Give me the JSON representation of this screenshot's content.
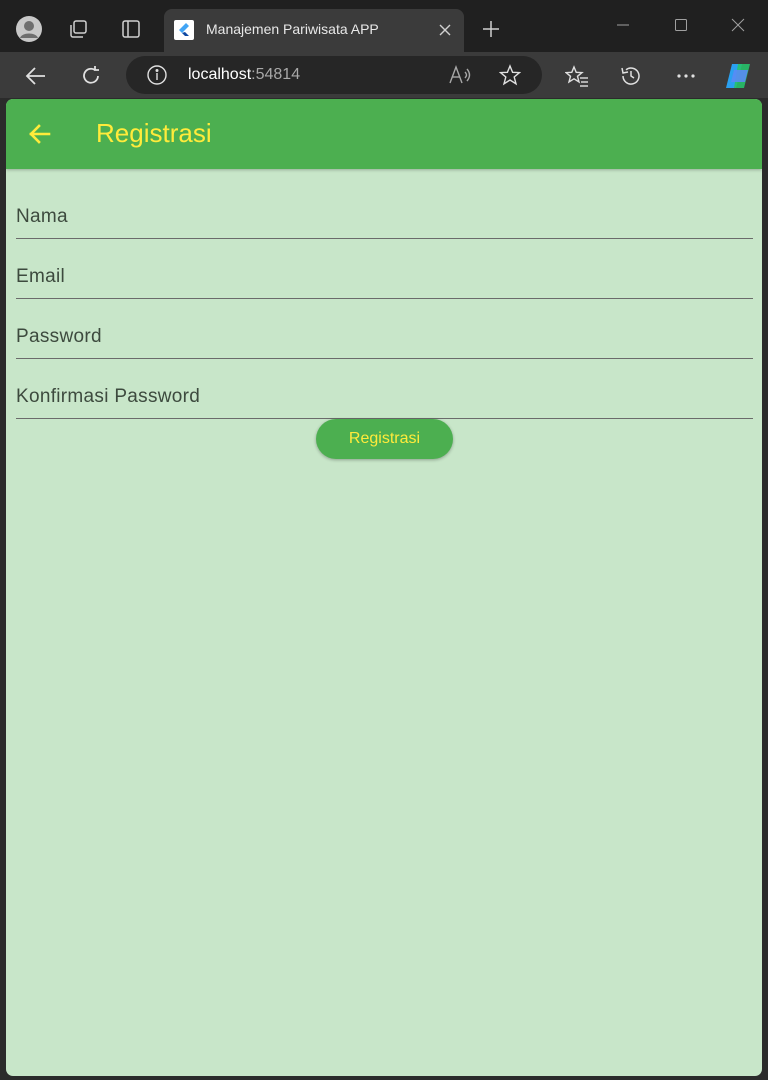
{
  "browser": {
    "tab_title": "Manajemen Pariwisata APP",
    "url_host": "localhost",
    "url_port": ":54814",
    "icons": [
      "profile-icon",
      "workspaces-icon",
      "tab-actions-icon",
      "favicon-icon",
      "tab-close-icon",
      "new-tab-icon",
      "minimize-icon",
      "maximize-icon",
      "close-icon",
      "back-icon",
      "refresh-icon",
      "site-info-icon",
      "read-aloud-icon",
      "favorite-star-icon",
      "favorites-icon",
      "history-icon",
      "more-icon",
      "copilot-icon"
    ]
  },
  "app": {
    "title": "Registrasi",
    "colors": {
      "appbar": "#4caf50",
      "title": "#ffeb3b",
      "background": "#c8e6c9"
    },
    "fields": [
      {
        "label": "Nama"
      },
      {
        "label": "Email"
      },
      {
        "label": "Password"
      },
      {
        "label": "Konfirmasi Password"
      }
    ],
    "submit_label": "Registrasi"
  }
}
